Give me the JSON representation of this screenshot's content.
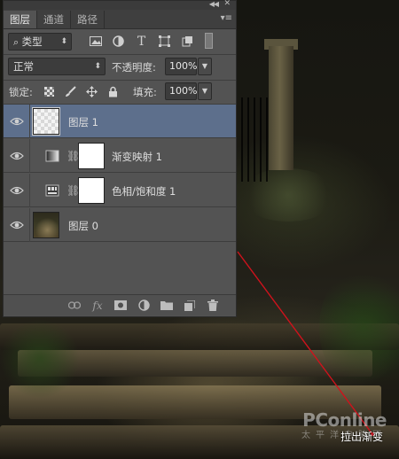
{
  "panel": {
    "tabs": [
      {
        "label": "图层",
        "active": true
      },
      {
        "label": "通道",
        "active": false
      },
      {
        "label": "路径",
        "active": false
      }
    ],
    "filter": {
      "label": "类型",
      "icon": "search-icon"
    },
    "blend": {
      "mode": "正常",
      "opacity_label": "不透明度:",
      "opacity_value": "100%"
    },
    "lock": {
      "label": "锁定:",
      "fill_label": "填充:",
      "fill_value": "100%"
    },
    "layers": [
      {
        "name": "图层 1",
        "selected": true,
        "visible": true,
        "thumb": "transparent-checker"
      },
      {
        "name": "渐变映射 1",
        "selected": false,
        "visible": true,
        "thumb": "adjustment-gradient-map",
        "mask": "white"
      },
      {
        "name": "色相/饱和度 1",
        "selected": false,
        "visible": true,
        "thumb": "adjustment-hue-saturation",
        "mask": "white"
      },
      {
        "name": "图层 0",
        "selected": false,
        "visible": true,
        "thumb": "photo"
      }
    ],
    "bottom_icons": [
      "link-icon",
      "fx-icon",
      "mask-icon",
      "adjustment-icon",
      "folder-icon",
      "new-layer-icon",
      "trash-icon"
    ],
    "bottom_fx_text": "fx"
  },
  "canvas": {
    "watermark_logo": "PConline",
    "watermark_sub": "太平洋电脑网",
    "caption": "拉出渐变",
    "gradient_line_color": "#d0121c"
  }
}
